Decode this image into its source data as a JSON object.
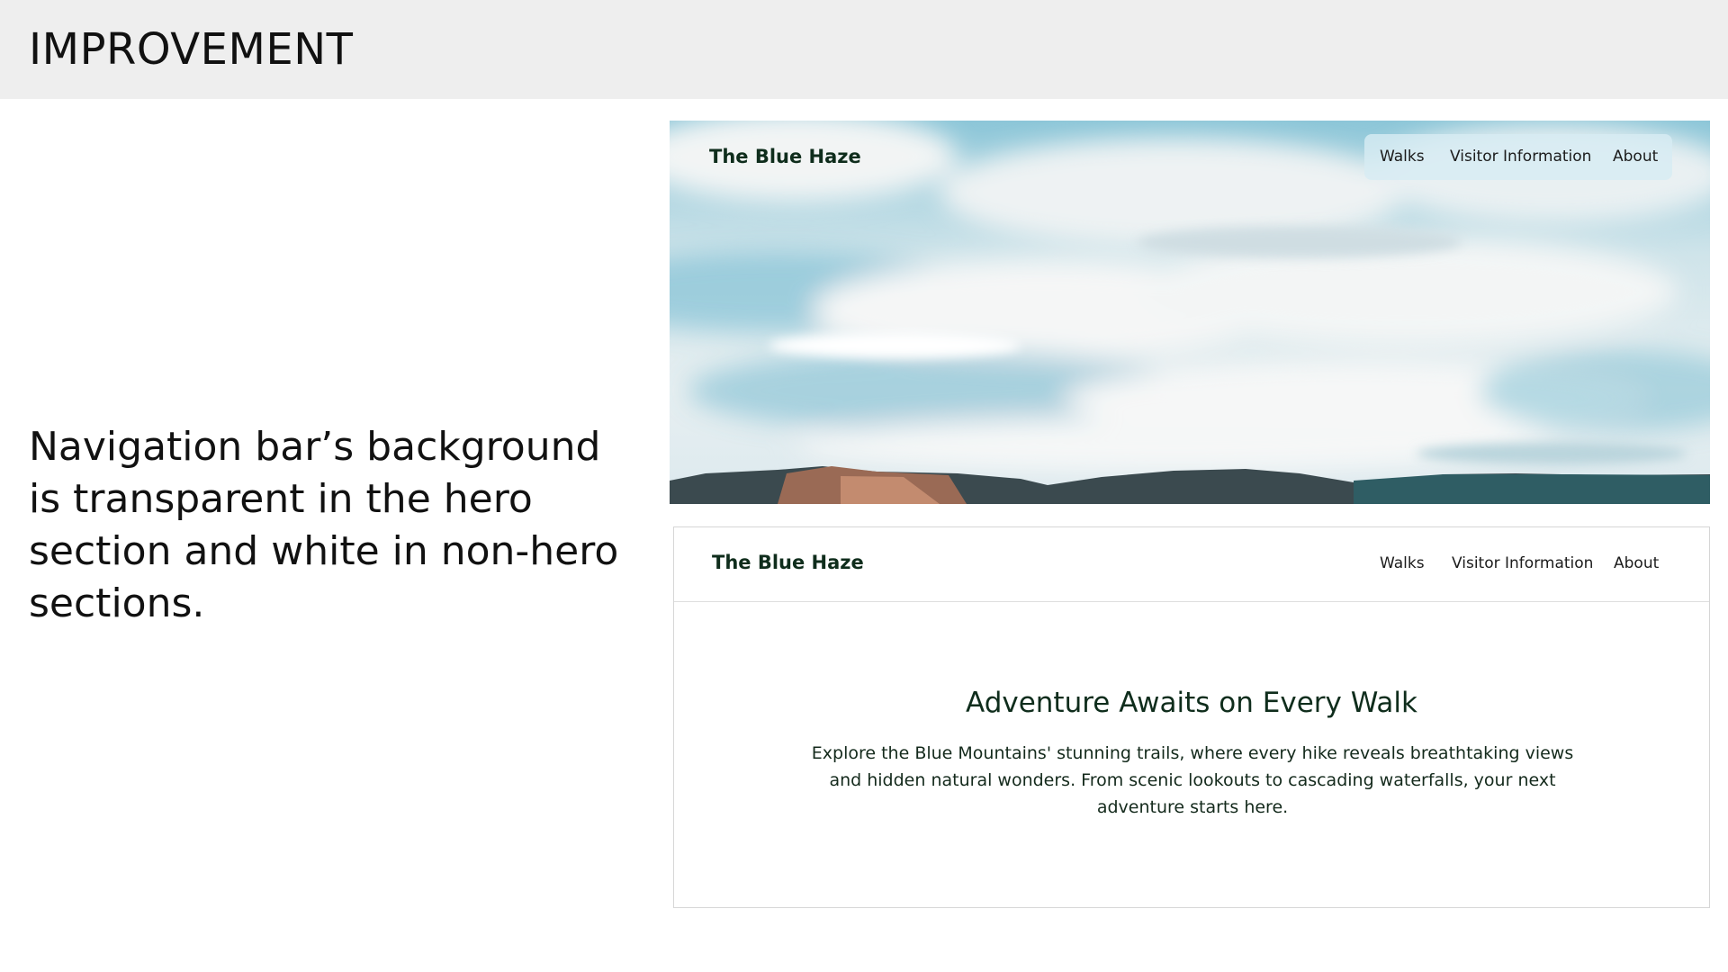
{
  "slide": {
    "title": "IMPROVEMENT",
    "description": "Navigation bar’s background is transparent in the hero section and white in non-hero sections."
  },
  "hero_preview": {
    "brand": "The Blue Haze",
    "nav_links": [
      "Walks",
      "Visitor Information",
      "About"
    ],
    "nav_background": "transparent"
  },
  "page_preview": {
    "brand": "The Blue Haze",
    "nav_links": [
      "Walks",
      "Visitor Information",
      "About"
    ],
    "nav_background": "#ffffff",
    "heading": "Adventure Awaits on Every Walk",
    "body": "Explore the Blue Mountains' stunning trails, where every hike reveals breathtaking views and hidden natural wonders. From scenic lookouts to cascading waterfalls, your next adventure starts here."
  },
  "colors": {
    "header_bg": "#eeeeee",
    "brand_text": "#0f2d1c",
    "sky": "#a9d6e4"
  }
}
